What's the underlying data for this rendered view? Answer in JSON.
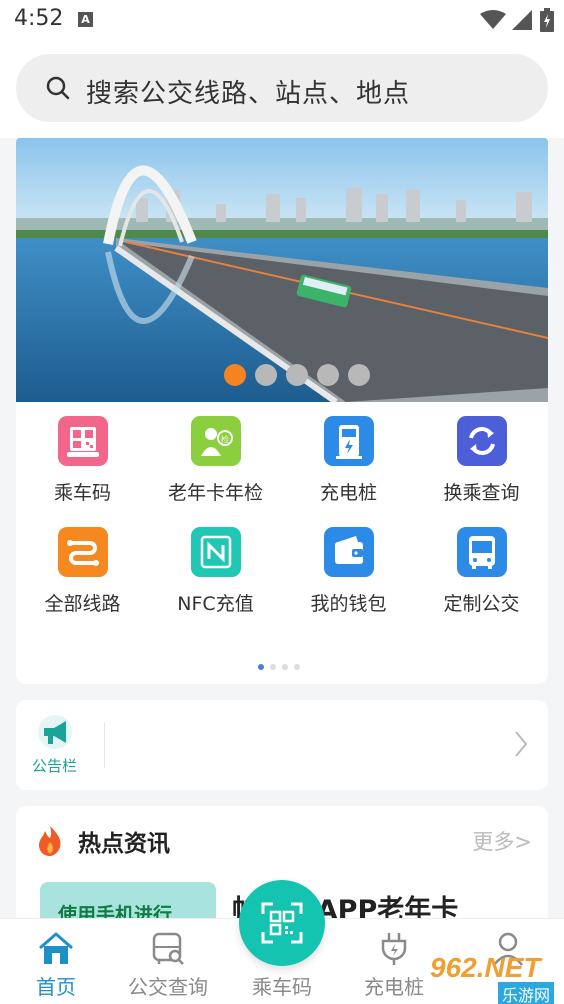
{
  "status_bar": {
    "time": "4:52",
    "a_icon_letter": "A"
  },
  "search": {
    "placeholder": "搜索公交线路、站点、地点"
  },
  "banner": {
    "slides": 5,
    "active_slide": 0
  },
  "grid": {
    "items": [
      {
        "label": "乘车码",
        "icon": "qr-code-icon",
        "color": "#f2668b"
      },
      {
        "label": "老年卡年检",
        "icon": "elder-card-icon",
        "color": "#8bcf3f"
      },
      {
        "label": "充电桩",
        "icon": "charging-pile-icon",
        "color": "#2b8be6"
      },
      {
        "label": "换乘查询",
        "icon": "transfer-icon",
        "color": "#4d5fd8"
      },
      {
        "label": "全部线路",
        "icon": "all-routes-icon",
        "color": "#f5891f"
      },
      {
        "label": "NFC充值",
        "icon": "nfc-icon",
        "color": "#1fc7b4"
      },
      {
        "label": "我的钱包",
        "icon": "wallet-icon",
        "color": "#2b8be6"
      },
      {
        "label": "定制公交",
        "icon": "custom-bus-icon",
        "color": "#2b8be6"
      }
    ],
    "pages": 4,
    "active_page": 0
  },
  "notice": {
    "label": "公告栏"
  },
  "news": {
    "title": "热点资讯",
    "more": "更多>",
    "thumb_text": "使用手机进行",
    "headline": "帕...州APP老年卡"
  },
  "tabbar": {
    "tabs": [
      {
        "label": "首页",
        "icon": "home-icon",
        "active": true
      },
      {
        "label": "公交查询",
        "icon": "bus-search-icon",
        "active": false
      },
      {
        "label": "乘车码",
        "icon": "qr-code-icon",
        "active": false
      },
      {
        "label": "充电桩",
        "icon": "plug-icon",
        "active": false
      },
      {
        "label": "",
        "icon": "user-icon",
        "active": false
      }
    ]
  },
  "watermark": {
    "text_main": "962.NET",
    "text_sub": "乐游网"
  },
  "colors": {
    "accent": "#1e90c8",
    "fab": "#14c3b0",
    "dot_active": "#f58320",
    "notice": "#1aa39a"
  }
}
